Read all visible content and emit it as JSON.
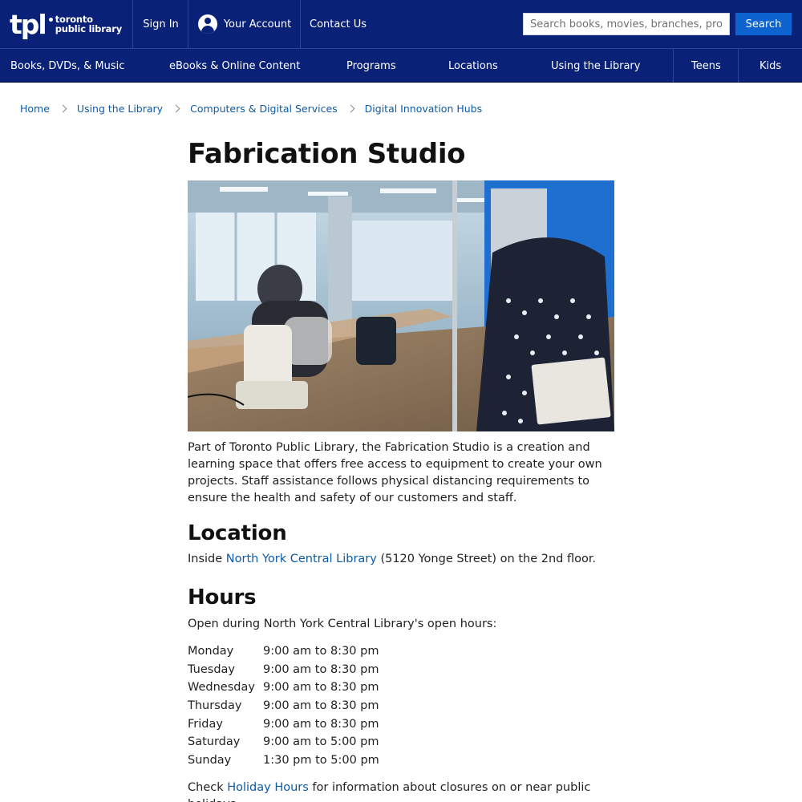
{
  "header": {
    "logo_mark": "tpl",
    "logo_line1": "toronto",
    "logo_line2": "public library",
    "sign_in": "Sign In",
    "your_account": "Your Account",
    "contact_us": "Contact Us",
    "search_placeholder": "Search books, movies, branches, programs",
    "search_button": "Search",
    "account_icon": "user-circle-icon"
  },
  "nav": {
    "items": [
      "Books, DVDs, & Music",
      "eBooks & Online Content",
      "Programs",
      "Locations",
      "Using the Library",
      "Teens",
      "Kids"
    ]
  },
  "breadcrumb": [
    "Home",
    "Using the Library",
    "Computers & Digital Services",
    "Digital Innovation Hubs"
  ],
  "page": {
    "title": "Fabrication Studio",
    "hero_image": "fabrication-studio-photo",
    "intro": "Part of Toronto Public Library, the Fabrication Studio is a creation and learning space that offers free access to equipment to create your own projects. Staff assistance follows physical distancing requirements to ensure the health and safety of our customers and staff.",
    "location_heading": "Location",
    "location_prefix": "Inside ",
    "location_link": "North York Central Library",
    "location_suffix": " (5120 Yonge Street) on the 2nd floor.",
    "hours_heading": "Hours",
    "hours_intro": "Open during North York Central Library's open hours:",
    "hours": [
      {
        "day": "Monday",
        "time": "9:00 am to 8:30 pm"
      },
      {
        "day": "Tuesday",
        "time": "9:00 am to 8:30 pm"
      },
      {
        "day": "Wednesday",
        "time": "9:00 am to 8:30 pm"
      },
      {
        "day": "Thursday",
        "time": "9:00 am to 8:30 pm"
      },
      {
        "day": "Friday",
        "time": "9:00 am to 8:30 pm"
      },
      {
        "day": "Saturday",
        "time": "9:00 am to 5:00 pm"
      },
      {
        "day": "Sunday",
        "time": "1:30 pm to 5:00 pm"
      }
    ],
    "holiday_prefix": "Check ",
    "holiday_link": "Holiday Hours",
    "holiday_suffix": " for information about closures on or near public holidays."
  },
  "colors": {
    "header_bg": "#0a2178",
    "search_button": "#0d63cf",
    "link": "#0d5aa7"
  }
}
